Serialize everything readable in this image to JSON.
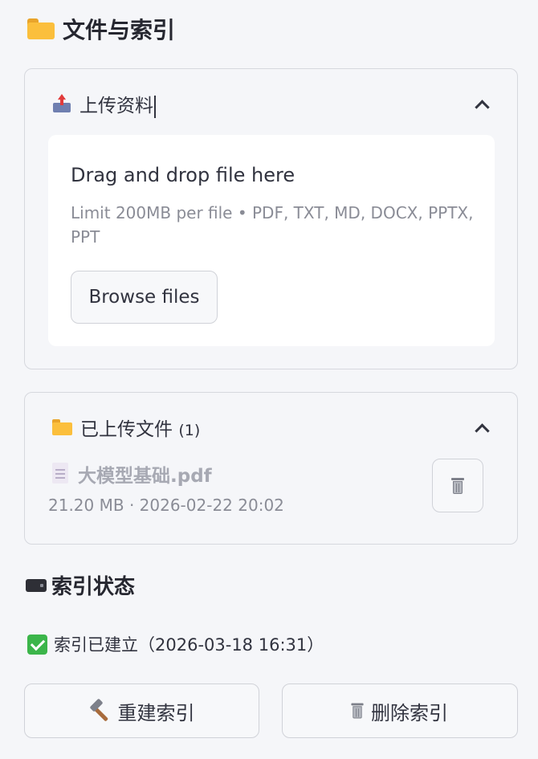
{
  "section": {
    "title": "文件与索引",
    "icon": "folder-icon"
  },
  "upload": {
    "header": "上传资料",
    "icon": "inbox-upload-icon",
    "dropzone_title": "Drag and drop file here",
    "dropzone_limit": "Limit 200MB per file • PDF, TXT, MD, DOCX, PPTX, PPT",
    "browse_label": "Browse files"
  },
  "uploaded": {
    "header": "已上传文件",
    "count": "(1)",
    "icon": "open-folder-icon",
    "files": [
      {
        "name": "大模型基础.pdf",
        "meta": "21.20 MB · 2026-02-22 20:02",
        "icon": "document-icon"
      }
    ]
  },
  "index": {
    "title": "索引状态",
    "icon": "drive-icon",
    "status": "索引已建立（2026-03-18 16:31）",
    "status_icon": "check-mark-icon",
    "rebuild_label": "重建索引",
    "delete_label": "删除索引"
  },
  "colors": {
    "background": "#f5f6f9",
    "card_border": "#d6d8de",
    "text": "#31333f",
    "muted": "#8a8c96",
    "success": "#3bb54a"
  }
}
